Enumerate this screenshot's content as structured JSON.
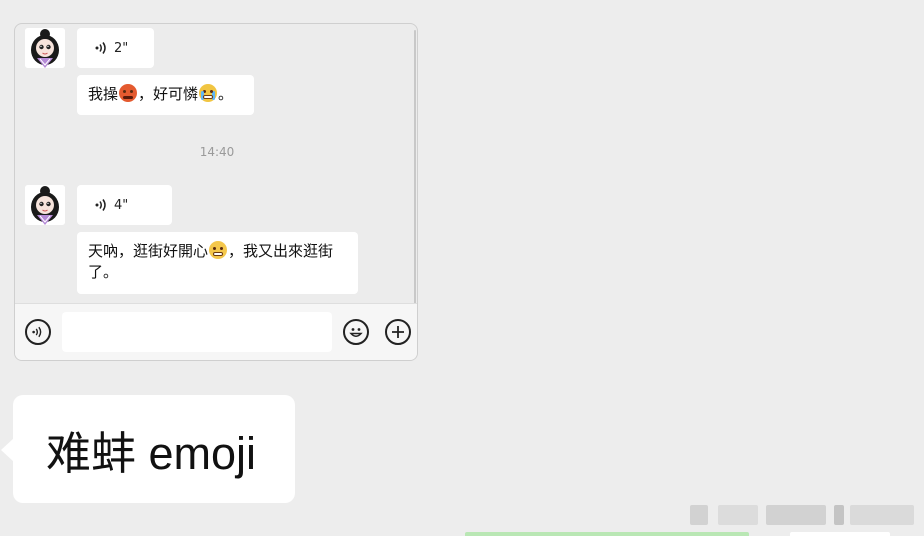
{
  "chat": {
    "messages": [
      {
        "type": "voice",
        "duration": "2\""
      },
      {
        "type": "text",
        "parts": [
          "我操",
          "，好可憐",
          "。"
        ],
        "emojis": [
          "angry-face",
          "crying-face"
        ]
      },
      {
        "type": "timestamp",
        "text": "14:40"
      },
      {
        "type": "voice",
        "duration": "4\""
      },
      {
        "type": "text",
        "parts": [
          "天吶，逛街好開心",
          "，我又出來逛街了。"
        ],
        "emojis": [
          "grinning-face"
        ]
      }
    ]
  },
  "input_bar": {
    "placeholder": "",
    "voice_icon": "voice-mode-icon",
    "emoji_icon": "emoji-icon",
    "plus_icon": "plus-icon"
  },
  "caption": {
    "text": "难蚌 emoji"
  },
  "colors": {
    "page_bg": "#ededed",
    "bubble": "#ffffff",
    "green_strip": "#b9e7b4"
  }
}
